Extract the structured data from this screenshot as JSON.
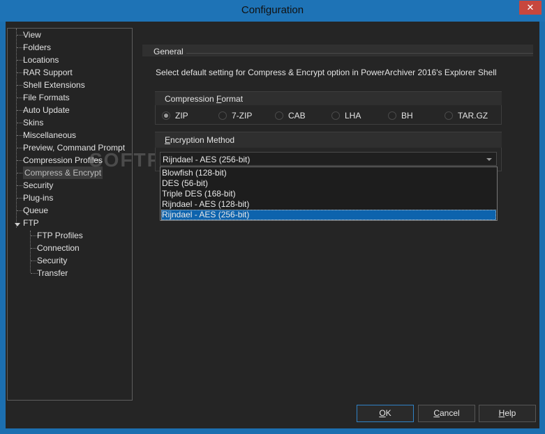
{
  "window": {
    "title": "Configuration",
    "close_glyph": "✕"
  },
  "tree": {
    "items": [
      {
        "label": "View"
      },
      {
        "label": "Folders"
      },
      {
        "label": "Locations"
      },
      {
        "label": "RAR Support"
      },
      {
        "label": "Shell Extensions"
      },
      {
        "label": "File Formats"
      },
      {
        "label": "Auto Update"
      },
      {
        "label": "Skins"
      },
      {
        "label": "Miscellaneous"
      },
      {
        "label": "Preview, Command Prompt"
      },
      {
        "label": "Compression Profiles"
      },
      {
        "label": "Compress & Encrypt"
      },
      {
        "label": "Security"
      },
      {
        "label": "Plug-ins"
      },
      {
        "label": "Queue"
      },
      {
        "label": "FTP"
      }
    ],
    "ftp_children": [
      {
        "label": "FTP Profiles"
      },
      {
        "label": "Connection"
      },
      {
        "label": "Security"
      },
      {
        "label": "Transfer"
      }
    ],
    "selected": "Compress & Encrypt",
    "watermark": "SOFTPEDIA"
  },
  "general": {
    "heading": "General",
    "description": "Select default setting for Compress & Encrypt option in PowerArchiver 2016's Explorer Shell"
  },
  "compression_format": {
    "caption_pre": "Compression ",
    "caption_underlined": "F",
    "caption_post": "ormat",
    "options": [
      "ZIP",
      "7-ZIP",
      "CAB",
      "LHA",
      "BH",
      "TAR.GZ"
    ],
    "selected": "ZIP"
  },
  "encryption_method": {
    "caption_underlined": "E",
    "caption_post": "ncryption Method",
    "value": "Rijndael - AES (256-bit)",
    "options": [
      "Blowfish (128-bit)",
      "DES (56-bit)",
      "Triple DES (168-bit)",
      "Rijndael - AES (128-bit)",
      "Rijndael - AES (256-bit)"
    ],
    "highlighted": "Rijndael - AES (256-bit)"
  },
  "buttons": {
    "ok_u": "O",
    "ok_rest": "K",
    "cancel_u": "C",
    "cancel_rest": "ancel",
    "help_u": "H",
    "help_rest": "elp"
  },
  "colors": {
    "title_bar": "#1e73b6",
    "background": "#252525",
    "selection": "#0d63ad"
  }
}
